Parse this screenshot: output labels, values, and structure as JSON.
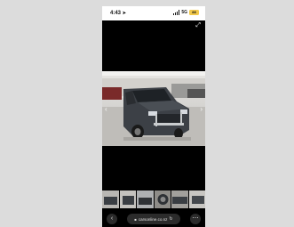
{
  "status_bar": {
    "time": "4:43",
    "network": "5G",
    "battery": "88"
  },
  "gallery": {
    "thumbnail_count": 6,
    "selected_index": 1
  },
  "browser": {
    "url": "carsonline.co.nz"
  },
  "icons": {
    "location": "location-arrow-icon",
    "expand": "expand-icon",
    "back": "back-icon",
    "lock": "lock-icon",
    "reload": "reload-icon",
    "more": "more-icon"
  }
}
